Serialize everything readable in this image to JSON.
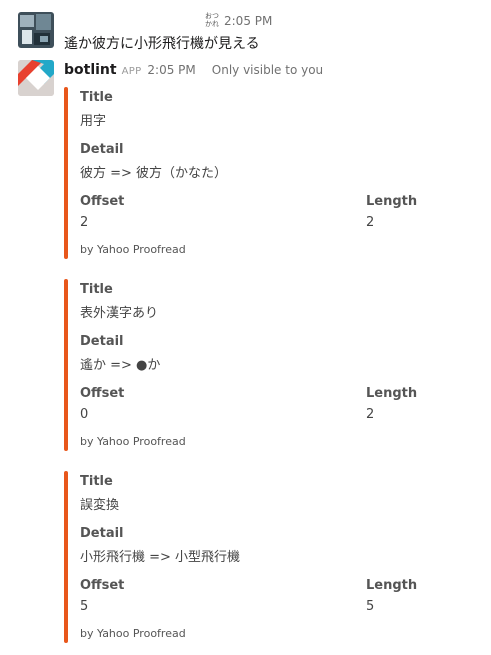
{
  "message1": {
    "status_tiny": "おつかれ",
    "time": "2:05 PM",
    "text": "遙か彼方に小形飛行機が見える"
  },
  "bot": {
    "name": "botlint",
    "badge": "APP",
    "time": "2:05 PM",
    "visibility": "Only visible to you"
  },
  "labels": {
    "title": "Title",
    "detail": "Detail",
    "offset": "Offset",
    "length": "Length",
    "footer": "by Yahoo Proofread"
  },
  "attachments": [
    {
      "title": "用字",
      "detail": "彼方 => 彼方（かなた）",
      "offset": "2",
      "length": "2"
    },
    {
      "title": "表外漢字あり",
      "detail": "遙か => ●か",
      "offset": "0",
      "length": "2"
    },
    {
      "title": "誤変換",
      "detail": "小形飛行機 => 小型飛行機",
      "offset": "5",
      "length": "5"
    }
  ],
  "colors": {
    "accent": "#e8571b"
  }
}
